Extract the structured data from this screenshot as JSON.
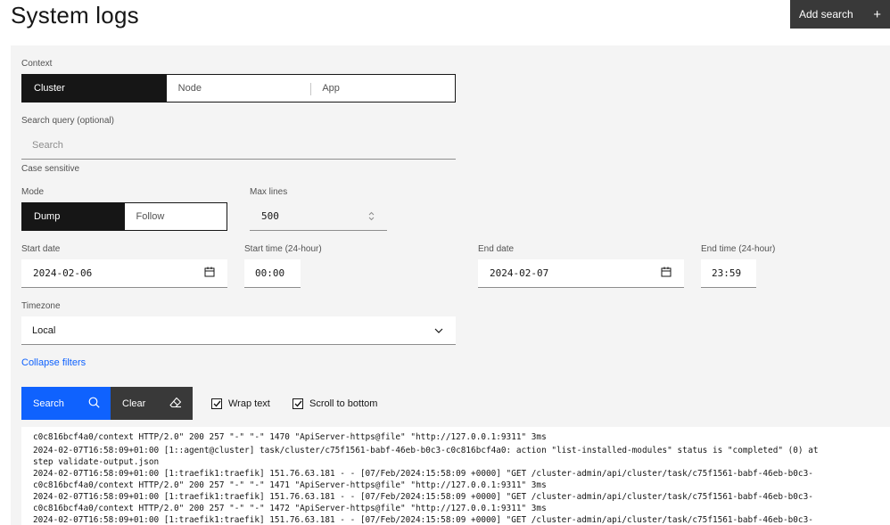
{
  "page_title": "System logs",
  "add_search_label": "Add search",
  "context": {
    "label": "Context",
    "options": [
      "Cluster",
      "Node",
      "App"
    ],
    "selected": "Cluster"
  },
  "search_query": {
    "label": "Search query (optional)",
    "placeholder": "Search",
    "value": ""
  },
  "case_sensitive_label": "Case sensitive",
  "mode": {
    "label": "Mode",
    "options": [
      "Dump",
      "Follow"
    ],
    "selected": "Dump"
  },
  "max_lines": {
    "label": "Max lines",
    "value": "500"
  },
  "start_date": {
    "label": "Start date",
    "value": "2024-02-06"
  },
  "start_time": {
    "label": "Start time (24-hour)",
    "value": "00:00"
  },
  "end_date": {
    "label": "End date",
    "value": "2024-02-07"
  },
  "end_time": {
    "label": "End time (24-hour)",
    "value": "23:59"
  },
  "timezone": {
    "label": "Timezone",
    "value": "Local"
  },
  "collapse_filters_label": "Collapse filters",
  "actions": {
    "search_label": "Search",
    "clear_label": "Clear"
  },
  "checkboxes": {
    "wrap_text": {
      "label": "Wrap text",
      "checked": true
    },
    "scroll_to_bottom": {
      "label": "Scroll to bottom",
      "checked": true
    }
  },
  "log_lines": [
    "c0c816bcf4a0/context HTTP/2.0\" 200 257 \"-\" \"-\" 1470 \"ApiServer-https@file\" \"http://127.0.0.1:9311\" 3ms",
    "2024-02-07T16:58:09+01:00 [1::agent@cluster] task/cluster/c75f1561-babf-46eb-b0c3-c0c816bcf4a0: action \"list-installed-modules\" status is \"completed\" (0) at",
    "step validate-output.json",
    "2024-02-07T16:58:09+01:00 [1:traefik1:traefik] 151.76.63.181 - - [07/Feb/2024:15:58:09 +0000] \"GET /cluster-admin/api/cluster/task/c75f1561-babf-46eb-b0c3-",
    "c0c816bcf4a0/context HTTP/2.0\" 200 257 \"-\" \"-\" 1471 \"ApiServer-https@file\" \"http://127.0.0.1:9311\" 3ms",
    "2024-02-07T16:58:09+01:00 [1:traefik1:traefik] 151.76.63.181 - - [07/Feb/2024:15:58:09 +0000] \"GET /cluster-admin/api/cluster/task/c75f1561-babf-46eb-b0c3-",
    "c0c816bcf4a0/context HTTP/2.0\" 200 257 \"-\" \"-\" 1472 \"ApiServer-https@file\" \"http://127.0.0.1:9311\" 3ms",
    "2024-02-07T16:58:09+01:00 [1:traefik1:traefik] 151.76.63.181 - - [07/Feb/2024:15:58:09 +0000] \"GET /cluster-admin/api/cluster/task/c75f1561-babf-46eb-b0c3-"
  ],
  "colors": {
    "primary": "#0f62fe",
    "dark": "#161616",
    "button_secondary": "#393939",
    "panel_bg": "#f4f4f4"
  },
  "icons": {
    "add": "plus-icon",
    "calendar": "calendar-icon",
    "dropdown": "chevron-down-icon",
    "search": "search-icon",
    "clear": "eraser-icon",
    "checkbox": "checkmark-icon"
  }
}
